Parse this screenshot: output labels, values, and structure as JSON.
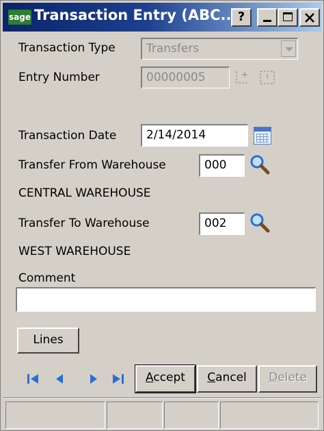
{
  "window": {
    "logo": "sage",
    "title": "Transaction Entry (ABC...",
    "help_label": "?"
  },
  "form": {
    "transaction_type_label": "Transaction Type",
    "transaction_type_value": "Transfers",
    "entry_number_label": "Entry Number",
    "entry_number_value": "00000005",
    "transaction_date_label": "Transaction Date",
    "transaction_date_value": "2/14/2014",
    "from_warehouse_label": "Transfer From Warehouse",
    "from_warehouse_value": "000",
    "from_warehouse_name": "CENTRAL WAREHOUSE",
    "to_warehouse_label": "Transfer To Warehouse",
    "to_warehouse_value": "002",
    "to_warehouse_name": "WEST WAREHOUSE",
    "comment_label": "Comment",
    "comment_value": ""
  },
  "buttons": {
    "lines": "Lines",
    "accept_first": "A",
    "accept_rest": "ccept",
    "cancel_first": "C",
    "cancel_rest": "ancel",
    "delete_first": "D",
    "delete_rest": "elete"
  },
  "icons": {
    "calendar": "calendar-icon",
    "lookup": "magnifier-icon",
    "nav_first": "first-record-icon",
    "nav_prev": "previous-record-icon",
    "nav_next": "next-record-icon",
    "nav_last": "last-record-icon"
  },
  "colors": {
    "titlebar_start": "#0a246a",
    "titlebar_end": "#a6caf0",
    "window_face": "#d4d0c8",
    "nav_icon": "#2a6fd6"
  }
}
